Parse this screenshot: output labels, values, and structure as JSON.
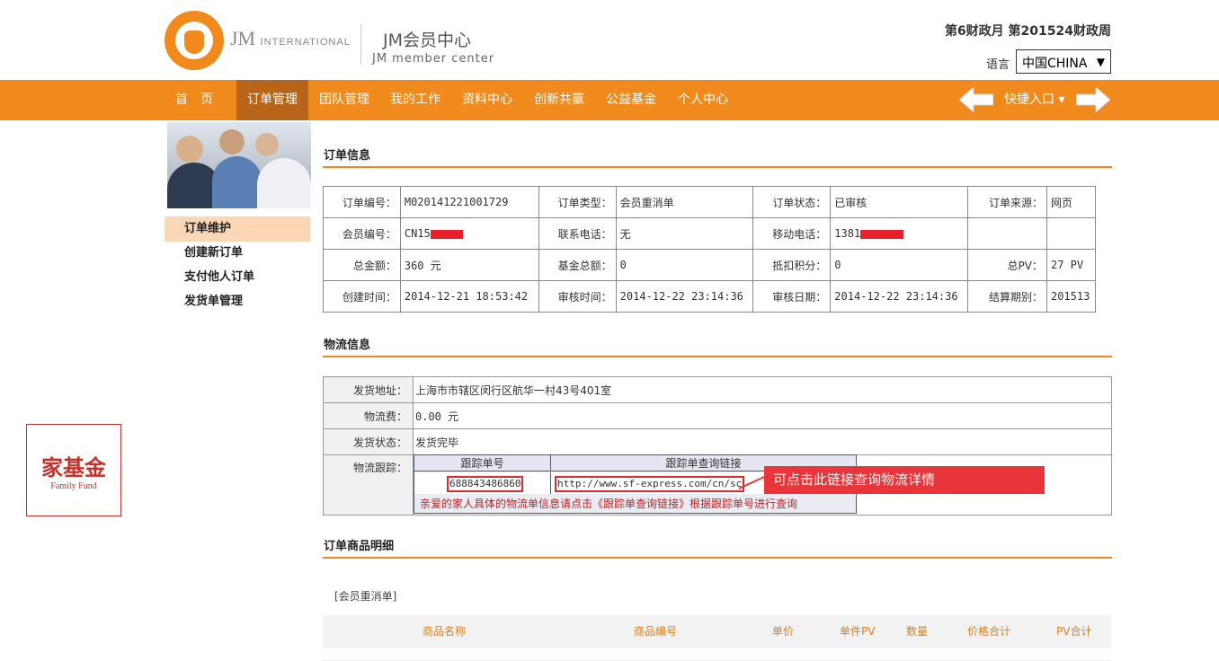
{
  "header": {
    "brand": "JM",
    "brand_small": "INTERNATIONAL",
    "center_cn": "JM会员中心",
    "center_en": "JM member center",
    "period": "第6财政月  第201524财政周",
    "lang_label": "语言",
    "lang_value": "中国CHINA"
  },
  "nav": {
    "items": [
      "首　页",
      "订单管理",
      "团队管理",
      "我的工作",
      "资料中心",
      "创新共赢",
      "公益基金",
      "个人中心"
    ],
    "active": "订单管理",
    "quick_entry": "快捷入口"
  },
  "sidebar": {
    "items": [
      "订单维护",
      "创建新订单",
      "支付他人订单",
      "发货单管理"
    ],
    "active": "订单维护"
  },
  "fund_badge": {
    "cn": "家基金",
    "en": "Family Fund"
  },
  "order_info": {
    "title": "订单信息",
    "rows": [
      [
        [
          "订单编号：",
          "M020141221001729"
        ],
        [
          "订单类型：",
          "会员重消单"
        ],
        [
          "订单状态：",
          "已审核"
        ],
        [
          "订单来源：",
          "网页"
        ]
      ],
      [
        [
          "会员编号：",
          "CN15"
        ],
        [
          "联系电话：",
          "无"
        ],
        [
          "移动电话：",
          "1381"
        ],
        [
          "",
          ""
        ]
      ],
      [
        [
          "总金额：",
          "360 元"
        ],
        [
          "基金总额：",
          "0"
        ],
        [
          "抵扣积分：",
          "0"
        ],
        [
          "总PV：",
          "27 PV"
        ]
      ],
      [
        [
          "创建时间：",
          "2014-12-21 18:53:42"
        ],
        [
          "审核时间：",
          "2014-12-22 23:14:36"
        ],
        [
          "审核日期：",
          "2014-12-22 23:14:36"
        ],
        [
          "结算期别：",
          "201513"
        ]
      ]
    ]
  },
  "logistics": {
    "title": "物流信息",
    "address_label": "发货地址：",
    "address": "上海市市辖区闵行区航华一村43号401室",
    "fee_label": "物流费：",
    "fee": "0.00 元",
    "status_label": "发货状态：",
    "status": "发货完毕",
    "tracking_label": "物流跟踪：",
    "col_number": "跟踪单号",
    "col_link": "跟踪单查询链接",
    "tracking_number": "688843486860",
    "tracking_link": "http://www.sf-express.com/cn/sc",
    "note": "亲爱的家人具体的物流单信息请点击《跟踪单查询链接》根据跟踪单号进行查询",
    "callout": "可点击此链接查询物流详情"
  },
  "goods": {
    "title": "订单商品明细",
    "tag": "[会员重消单]",
    "headers": [
      "商品名称",
      "商品编号",
      "单价",
      "单件PV",
      "数量",
      "价格合计",
      "PV合计"
    ]
  },
  "colors": {
    "accent": "#f08a1c",
    "nav_active": "#b8651a",
    "highlight_red": "#e9353a"
  }
}
